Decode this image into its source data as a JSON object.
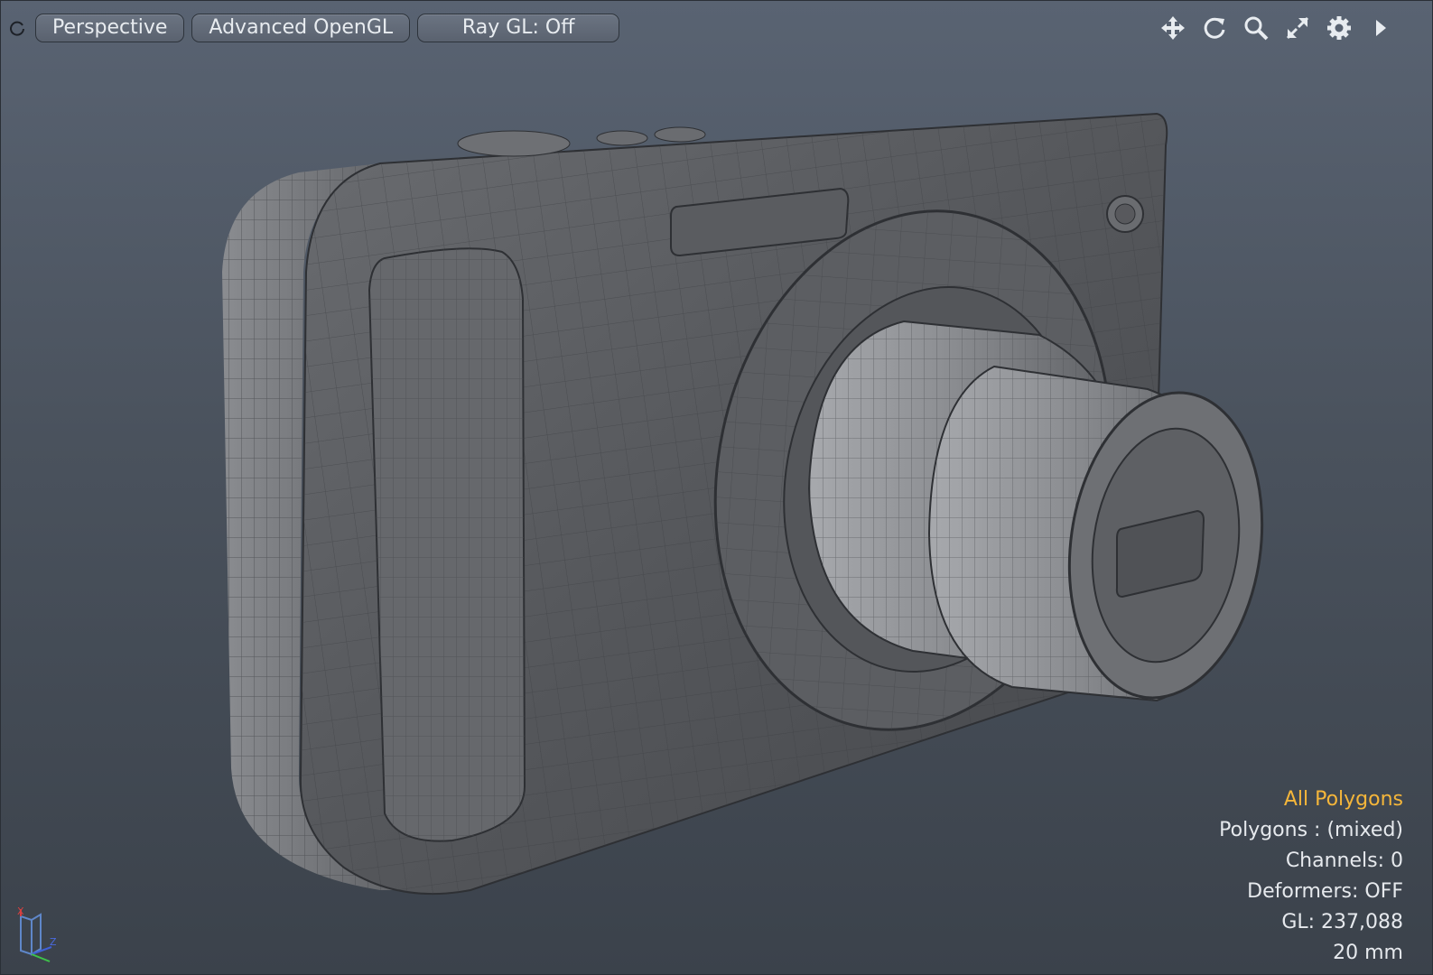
{
  "toolbar": {
    "view_label": "Perspective",
    "shading_label": "Advanced OpenGL",
    "raygl_label": "Ray GL: Off"
  },
  "tools": [
    "move-icon",
    "rotate-icon",
    "zoom-icon",
    "maximize-icon",
    "gear-icon",
    "expand-arrow-icon"
  ],
  "info": {
    "selection": "All Polygons",
    "polygons": "Polygons : (mixed)",
    "channels": "Channels: 0",
    "deformers": "Deformers: OFF",
    "gl": "GL: 237,088",
    "focal": "20 mm"
  },
  "colors": {
    "accent": "#f5b63a",
    "background_top": "#596372",
    "background_bottom": "#3b424b",
    "mesh": "#5a5c60"
  }
}
